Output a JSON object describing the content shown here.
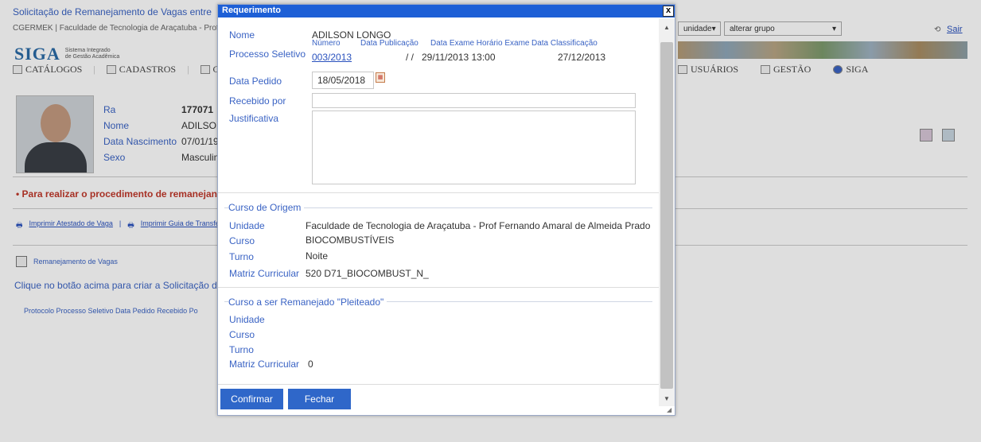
{
  "background": {
    "title": "Solicitação de Remanejamento de Vagas entre",
    "breadcrumb": "CGERMEK | Faculdade de Tecnologia de Araçatuba - Prof F",
    "logo_mark": "SIGA",
    "logo_tag_line1": "Sistema Integrado",
    "logo_tag_line2": "de Gestão Acadêmica",
    "menu": [
      "CATÁLOGOS",
      "CADASTROS",
      "CUR"
    ],
    "menu_right": [
      "USUÁRIOS",
      "GESTÃO",
      "SIGA"
    ],
    "select_unidade": "unidade",
    "select_grupo": "alterar grupo",
    "logout": "Sair",
    "student": {
      "ra_label": "Ra",
      "ra_value": "177071",
      "nome_label": "Nome",
      "nome_value": "ADILSON",
      "nasc_label": "Data Nascimento",
      "nasc_value": "07/01/19",
      "sexo_label": "Sexo",
      "sexo_value": "Masculin"
    },
    "notice": "Para realizar o procedimento de remanejan",
    "print_links": [
      "Imprimir Atestado de Vaga",
      "Imprimir Guia de Transferê"
    ],
    "remanejamento_button": "Remanejamento de Vagas",
    "instruction": "Clique no botão acima para criar a Solicitação d",
    "table_headers": "Protocolo Processo Seletivo Data Pedido Recebido Po"
  },
  "modal": {
    "title": "Requerimento",
    "close_label": "x",
    "nome_label": "Nome",
    "nome_value": "ADILSON LONGO",
    "processo_label": "Processo Seletivo",
    "processo_headers": {
      "numero": "Número",
      "data_publicacao": "Data Publicação",
      "data_exame_horario": "Data Exame Horário Exame",
      "data_classificacao": "Data Classificação"
    },
    "processo_values": {
      "numero": "003/2013",
      "data_publicacao": "/ /",
      "data_exame_horario": "29/11/2013 13:00",
      "data_classificacao": "27/12/2013"
    },
    "data_pedido_label": "Data Pedido",
    "data_pedido_value": "18/05/2018",
    "recebido_label": "Recebido por",
    "recebido_value": "",
    "justificativa_label": "Justificativa",
    "justificativa_value": "",
    "origem": {
      "legend": "Curso de Origem",
      "unidade_label": "Unidade",
      "unidade_value": "Faculdade de Tecnologia de Araçatuba - Prof Fernando Amaral de Almeida Prado",
      "curso_label": "Curso",
      "curso_value": "BIOCOMBUSTÍVEIS",
      "turno_label": "Turno",
      "turno_value": "Noite",
      "matriz_label": "Matriz Curricular",
      "matriz_value": "520 D71_BIOCOMBUST_N_"
    },
    "pleiteado": {
      "legend": "Curso a ser Remanejado \"Pleiteado\"",
      "unidade_label": "Unidade",
      "curso_label": "Curso",
      "turno_label": "Turno",
      "matriz_label": "Matriz Curricular",
      "matriz_value": "0"
    },
    "confirm_label": "Confirmar",
    "close_button_label": "Fechar"
  },
  "colors": {
    "header_blue": "#1d5fd6",
    "label_blue": "#3a63c4",
    "button_blue": "#2f67c9",
    "notice_red": "#c0392b"
  },
  "icons": [
    "calendar-icon",
    "printer-icon",
    "document-icon",
    "refresh-icon",
    "help-icon",
    "close-icon"
  ]
}
